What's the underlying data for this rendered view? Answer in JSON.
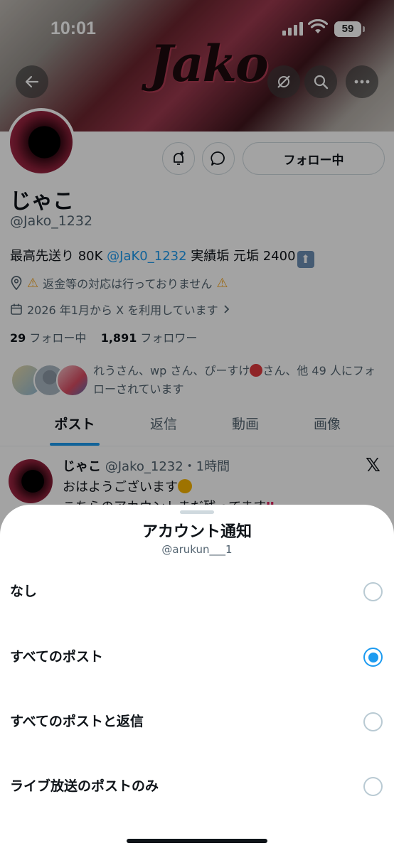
{
  "status_bar": {
    "time": "10:01",
    "battery": "59"
  },
  "banner": {
    "wordmark": "Jako"
  },
  "profile": {
    "display_name": "じゃこ",
    "handle": "@Jako_1232",
    "follow_button": "フォロー中",
    "bio_prefix": "最高先送り 80K ",
    "bio_mention": "@JaK0_1232",
    "bio_suffix": " 実績垢 元垢 2400",
    "location": "返金等の対応は行っておりません",
    "joined": "2026 年1月から X を利用しています",
    "following_count": "29",
    "following_label": "フォロー中",
    "followers_count": "1,891",
    "followers_label": "フォロワー",
    "followed_by": "れうさん、wp さん、ぴーすけ",
    "followed_by_suffix": "さん、他 49 人にフォローされています"
  },
  "tabs": [
    "ポスト",
    "返信",
    "動画",
    "画像"
  ],
  "post": {
    "author": "じゃこ",
    "handle_time": "@Jako_1232・1時間",
    "line1": "おはようございます",
    "line2": "こちらのアカウントまだ残ってます"
  },
  "sheet": {
    "title": "アカウント通知",
    "subtitle": "@arukun___1",
    "options": [
      {
        "label": "なし",
        "selected": false
      },
      {
        "label": "すべてのポスト",
        "selected": true
      },
      {
        "label": "すべてのポストと返信",
        "selected": false
      },
      {
        "label": "ライブ放送のポストのみ",
        "selected": false
      }
    ]
  },
  "colors": {
    "accent": "#1d9bf0",
    "text": "#0f1419",
    "secondary": "#536471"
  }
}
